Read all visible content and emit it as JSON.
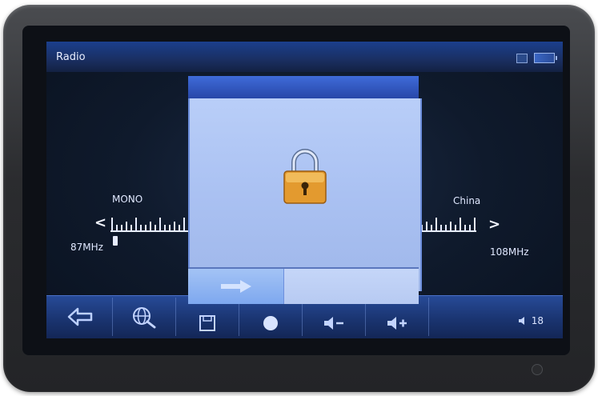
{
  "screen": {
    "title": "Radio"
  },
  "tuner": {
    "mode_label": "MONO",
    "region_label": "China",
    "min_freq": "87MHz",
    "max_freq": "108MHz",
    "prev_glyph": "<",
    "next_glyph": ">"
  },
  "toolbar": {
    "volume_value": "18"
  },
  "colors": {
    "accent": "#2747a8",
    "dialog_bg": "#aac1f2",
    "text": "#e0e8ff"
  },
  "icons": [
    "back-arrow-icon",
    "scan-globe-icon",
    "save-icon",
    "record-icon",
    "volume-down-icon",
    "volume-up-icon",
    "speaker-icon",
    "lock-icon",
    "confirm-arrow-icon",
    "battery-icon"
  ]
}
